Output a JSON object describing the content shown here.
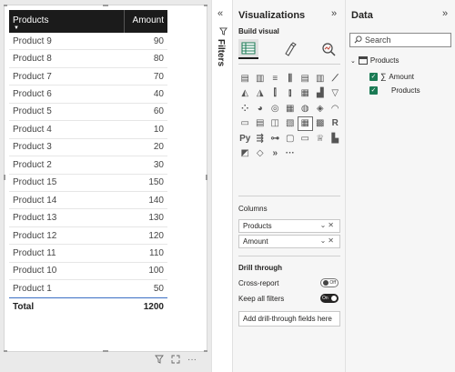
{
  "table": {
    "columns": [
      "Products",
      "Amount"
    ],
    "rows": [
      {
        "product": "Product 9",
        "amount": "90"
      },
      {
        "product": "Product 8",
        "amount": "80"
      },
      {
        "product": "Product 7",
        "amount": "70"
      },
      {
        "product": "Product 6",
        "amount": "40"
      },
      {
        "product": "Product 5",
        "amount": "60"
      },
      {
        "product": "Product 4",
        "amount": "10"
      },
      {
        "product": "Product 3",
        "amount": "20"
      },
      {
        "product": "Product 2",
        "amount": "30"
      },
      {
        "product": "Product 15",
        "amount": "150"
      },
      {
        "product": "Product 14",
        "amount": "140"
      },
      {
        "product": "Product 13",
        "amount": "130"
      },
      {
        "product": "Product 12",
        "amount": "120"
      },
      {
        "product": "Product 11",
        "amount": "110"
      },
      {
        "product": "Product 10",
        "amount": "100"
      },
      {
        "product": "Product 1",
        "amount": "50"
      }
    ],
    "total_label": "Total",
    "total_value": "1200"
  },
  "filters": {
    "label": "Filters"
  },
  "visualizations": {
    "title": "Visualizations",
    "build_label": "Build visual",
    "columns_label": "Columns",
    "wells": [
      "Products",
      "Amount"
    ],
    "drill_label": "Drill through",
    "cross_report_label": "Cross-report",
    "cross_report_state": "Off",
    "keep_filters_label": "Keep all filters",
    "keep_filters_state": "On",
    "drill_field_placeholder": "Add drill-through fields here"
  },
  "data_pane": {
    "title": "Data",
    "search_placeholder": "Search",
    "table_name": "Products",
    "fields": [
      {
        "name": "Amount",
        "sigma": true
      },
      {
        "name": "Products",
        "sigma": false
      }
    ]
  },
  "colors": {
    "accent_green": "#1a7a54",
    "header_black": "#1b1b1b",
    "total_underline": "#3a6fc4"
  }
}
